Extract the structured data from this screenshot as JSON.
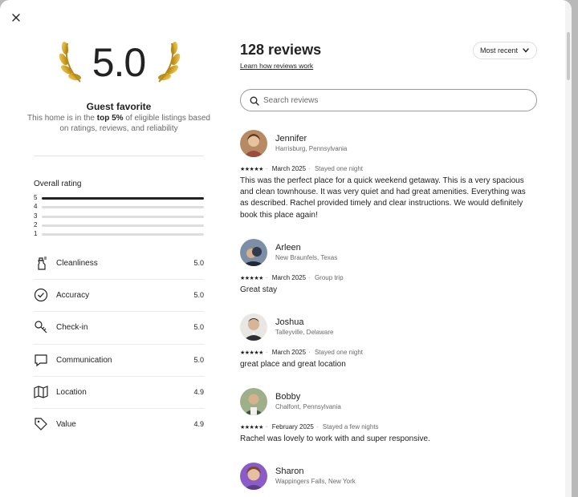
{
  "left": {
    "score": "5.0",
    "guest_favorite": "Guest favorite",
    "desc_prefix": "This home is in the ",
    "desc_bold": "top 5%",
    "desc_suffix": " of eligible listings based on ratings, reviews, and reliability",
    "overall_label": "Overall rating",
    "distribution": [
      {
        "stars": "5",
        "fraction": 1.0
      },
      {
        "stars": "4",
        "fraction": 0.0
      },
      {
        "stars": "3",
        "fraction": 0.0
      },
      {
        "stars": "2",
        "fraction": 0.0
      },
      {
        "stars": "1",
        "fraction": 0.0
      }
    ],
    "categories": [
      {
        "name": "Cleanliness",
        "value": "5.0",
        "icon": "spray-bottle-icon"
      },
      {
        "name": "Accuracy",
        "value": "5.0",
        "icon": "check-circle-icon"
      },
      {
        "name": "Check-in",
        "value": "5.0",
        "icon": "key-icon"
      },
      {
        "name": "Communication",
        "value": "5.0",
        "icon": "chat-bubble-icon"
      },
      {
        "name": "Location",
        "value": "4.9",
        "icon": "map-icon"
      },
      {
        "name": "Value",
        "value": "4.9",
        "icon": "tag-icon"
      }
    ]
  },
  "right": {
    "review_count": "128 reviews",
    "learn_link": "Learn how reviews work",
    "sort_label": "Most recent",
    "search_placeholder": "Search reviews",
    "reviews": [
      {
        "name": "Jennifer",
        "location": "Harrisburg, Pennsylvania",
        "stars": "★★★★★",
        "date": "March 2025",
        "stay": "Stayed one night",
        "text": "This was the perfect place for a quick weekend getaway. This is a very spacious and clean townhouse. It was very quiet and had great amenities. Everything was as described. Rachel provided timely and clear instructions. We would definitely book this place again!"
      },
      {
        "name": "Arleen",
        "location": "New Braunfels, Texas",
        "stars": "★★★★★",
        "date": "March 2025",
        "stay": "Group trip",
        "text": "Great stay"
      },
      {
        "name": "Joshua",
        "location": "Talleyville, Delaware",
        "stars": "★★★★★",
        "date": "March 2025",
        "stay": "Stayed one night",
        "text": "great place and great location"
      },
      {
        "name": "Bobby",
        "location": "Chalfont, Pennsylvania",
        "stars": "★★★★★",
        "date": "February 2025",
        "stay": "Stayed a few nights",
        "text": "Rachel was lovely to work with and super responsive."
      },
      {
        "name": "Sharon",
        "location": "Wappingers Falls, New York",
        "stars": "",
        "date": "",
        "stay": "",
        "text": ""
      }
    ]
  },
  "colors": {
    "text": "#222222",
    "muted": "#6a6a6a",
    "gold": "#c9a227"
  }
}
